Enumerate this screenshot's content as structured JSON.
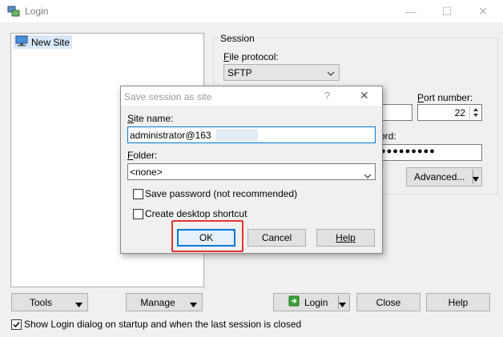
{
  "window": {
    "title": "Login",
    "minimize_icon": "minimize-icon",
    "maximize_icon": "maximize-icon",
    "close_icon": "close-icon"
  },
  "tree": {
    "items": [
      {
        "label": "New Site",
        "icon": "monitor-icon"
      }
    ]
  },
  "session": {
    "group_label": "Session",
    "file_protocol_label": "File protocol:",
    "file_protocol_value": "SFTP",
    "port_label": "Port number:",
    "port_value": "22",
    "password_label_partial": "ord:",
    "password_mask": "●●●●●●●●●",
    "advanced_label": "Advanced..."
  },
  "bottom": {
    "tools_label": "Tools",
    "manage_label": "Manage",
    "login_label": "Login",
    "close_label": "Close",
    "help_label": "Help",
    "show_dialog_label": "Show Login dialog on startup and when the last session is closed",
    "show_dialog_checked": true
  },
  "dialog": {
    "title": "Save session as site",
    "help_glyph": "?",
    "site_name_label": "Site name:",
    "site_name_value": "administrator@163",
    "folder_label": "Folder:",
    "folder_value": "<none>",
    "save_password_label": "Save password (not recommended)",
    "save_password_checked": false,
    "desktop_shortcut_label": "Create desktop shortcut",
    "desktop_shortcut_checked": false,
    "ok_label": "OK",
    "cancel_label": "Cancel",
    "help_label": "Help"
  },
  "colors": {
    "accent": "#0078d7",
    "highlight": "#e3342f",
    "login_icon": "#3aa53a"
  }
}
